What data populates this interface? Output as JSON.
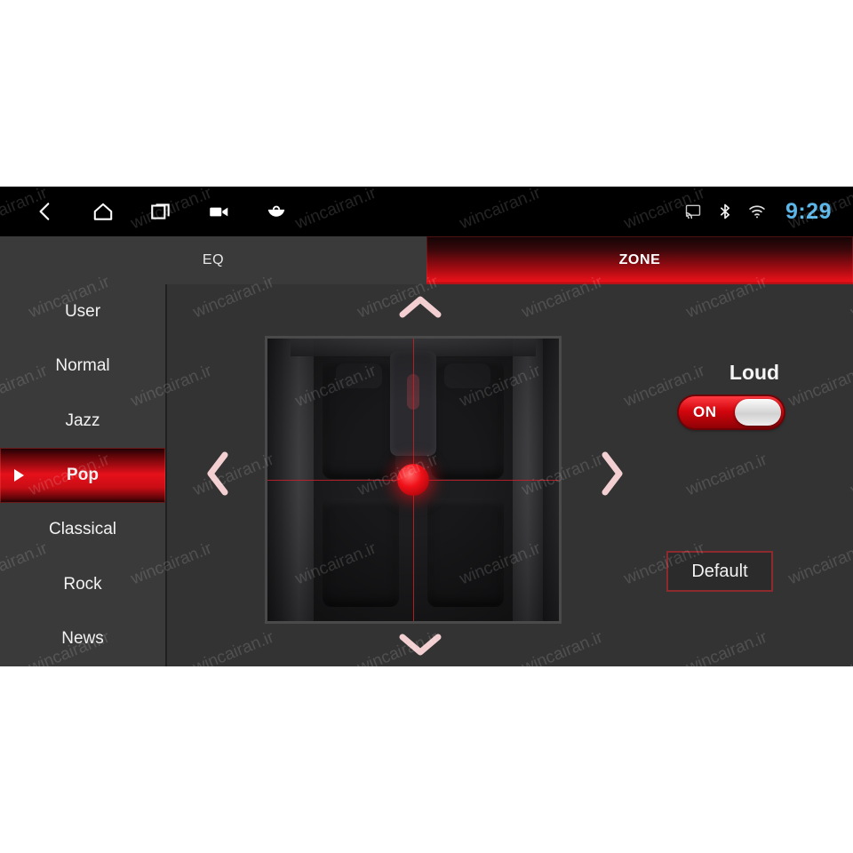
{
  "statusbar": {
    "nav_icons": [
      {
        "name": "back-icon",
        "label": "Back"
      },
      {
        "name": "home-icon",
        "label": "Home"
      },
      {
        "name": "recents-icon",
        "label": "Recent apps"
      },
      {
        "name": "video-camera-icon",
        "label": "Camera"
      },
      {
        "name": "bag-icon",
        "label": "Apps"
      }
    ],
    "system_icons": [
      {
        "name": "cast-icon",
        "label": "Cast"
      },
      {
        "name": "bluetooth-icon",
        "label": "Bluetooth"
      },
      {
        "name": "wifi-icon",
        "label": "Wi-Fi"
      }
    ],
    "clock": "9:29",
    "clock_color": "#5ab6e8"
  },
  "tabs": [
    {
      "label": "EQ",
      "active": false
    },
    {
      "label": "ZONE",
      "active": true
    }
  ],
  "presets": {
    "items": [
      {
        "label": "User",
        "selected": false
      },
      {
        "label": "Normal",
        "selected": false
      },
      {
        "label": "Jazz",
        "selected": false
      },
      {
        "label": "Pop",
        "selected": true
      },
      {
        "label": "Classical",
        "selected": false
      },
      {
        "label": "Rock",
        "selected": false
      },
      {
        "label": "News",
        "selected": false
      }
    ],
    "selected": "Pop"
  },
  "fader": {
    "title": "car-cabin-zone-pad",
    "arrows": [
      {
        "name": "fader-up-arrow",
        "glyph": "chevron-up"
      },
      {
        "name": "fader-down-arrow",
        "glyph": "chevron-down"
      },
      {
        "name": "fader-left-arrow",
        "glyph": "chevron-left"
      },
      {
        "name": "fader-right-arrow",
        "glyph": "chevron-right"
      }
    ],
    "position_marker": "center",
    "marker_color": "#e6101a"
  },
  "controls": {
    "loud_label": "Loud",
    "loud_state": "ON",
    "default_label": "Default"
  },
  "theme": {
    "accent_red": "#e6101a",
    "panel_bg": "#333333",
    "list_bg": "#3a3a3a",
    "statusbar_bg": "#000000"
  },
  "watermark": {
    "text": "wincairan.ir"
  }
}
